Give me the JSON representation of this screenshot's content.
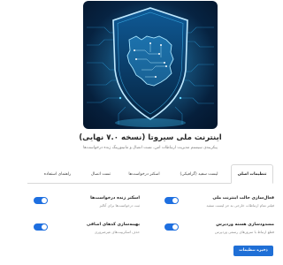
{
  "hero": {
    "icon": "iran-map-shield-circuit-illustration"
  },
  "title": "اینترنت ملی سیروتا (نسخه ۷.۰ نهایی)",
  "subtitle": "پیکربندی سیستم مدیریت ارتباطات امن، تست اتصال و مانیتورینگ زنده درخواست‌ها",
  "tabs": [
    {
      "label": "تنظیمات اصلی",
      "active": true
    },
    {
      "label": "لیست سفید (گرافیکی)",
      "active": false
    },
    {
      "label": "اسکنر درخواست‌ها",
      "active": false
    },
    {
      "label": "تست اتصال",
      "active": false
    },
    {
      "label": "راهنمای استفاده",
      "active": false
    }
  ],
  "settings": [
    {
      "label": "فعال‌سازی حالت اینترنت ملی",
      "desc": "فیلتر تمام ارتباطات خارجی به جز لیست سفید",
      "enabled": true
    },
    {
      "label": "اسکنر زنده درخواست‌ها",
      "desc": "ثبت درخواست‌ها برای آنالیز",
      "enabled": true
    },
    {
      "label": "مسدودسازی هسته وردپرس",
      "desc": "قطع ارتباط با سرورهای رسمی وردپرس",
      "enabled": true
    },
    {
      "label": "بهینه‌سازی کدهای اضافی",
      "desc": "حذف اسکریپت‌های غیرضروری",
      "enabled": true
    }
  ],
  "save_label": "ذخیره تنظیمات اصلی",
  "colors": {
    "accent": "#1e6fe0",
    "hero_bg": "#082a4d",
    "glow": "#3fc6ff"
  }
}
